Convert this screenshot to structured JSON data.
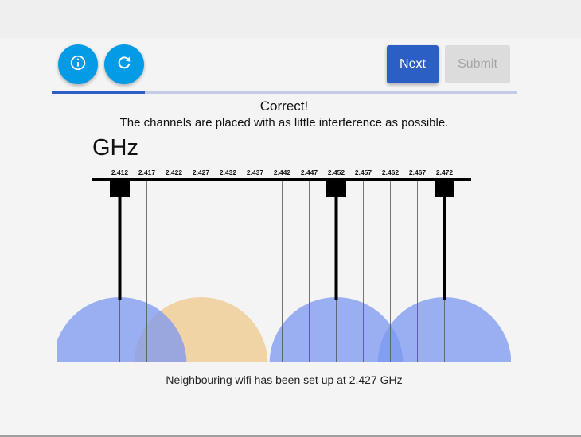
{
  "toolbar": {
    "info_icon": "info-icon",
    "reset_icon": "refresh-icon",
    "next_label": "Next",
    "submit_label": "Submit",
    "progress_fraction": 0.2,
    "accent_color": "#2b5fc4",
    "round_button_color": "#039be5"
  },
  "status": {
    "title": "Correct!",
    "message": "The channels are placed with as little interference as possible."
  },
  "diagram": {
    "unit_label": "GHz",
    "frequencies": [
      "2.412",
      "2.417",
      "2.422",
      "2.427",
      "2.432",
      "2.437",
      "2.442",
      "2.447",
      "2.452",
      "2.457",
      "2.462",
      "2.467",
      "2.472"
    ],
    "placed_channels": [
      "2.412",
      "2.452",
      "2.472"
    ],
    "neighbour_channel": "2.427",
    "placed_color": "#7b98f0",
    "neighbour_color": "#f0c98c"
  },
  "footer": {
    "message": "Neighbouring wifi has been set up at 2.427 GHz"
  }
}
